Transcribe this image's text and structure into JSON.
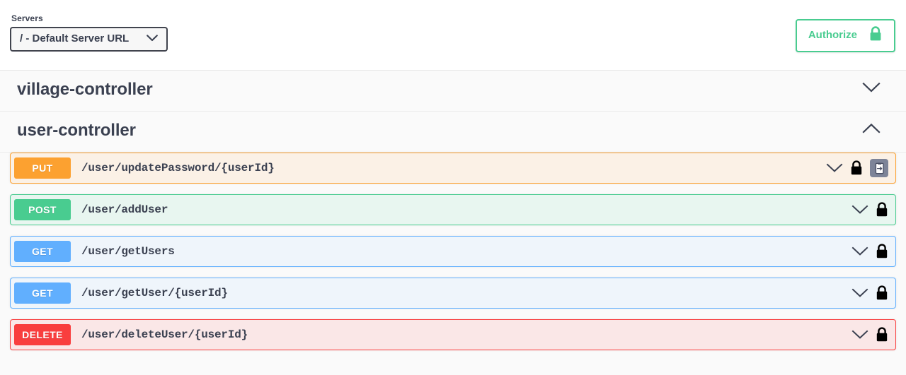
{
  "header": {
    "servers_label": "Servers",
    "server_selected": "/ - Default Server URL",
    "server_options": [
      "/ - Default Server URL"
    ],
    "authorize_label": "Authorize",
    "authorize_icon": "lock-icon",
    "authorize_color": "#49cc90"
  },
  "tags": [
    {
      "name": "village-controller",
      "expanded": false,
      "arrow_icon": "chevron-down-icon",
      "operations": []
    },
    {
      "name": "user-controller",
      "expanded": true,
      "arrow_icon": "chevron-up-icon",
      "operations": [
        {
          "method": "PUT",
          "path": "/user/updatePassword/{userId}",
          "method_color": "#fca130",
          "background_color": "#fbf1e6",
          "icons": [
            "chevron-down-icon",
            "lock-icon",
            "copy-to-clipboard-icon"
          ]
        },
        {
          "method": "POST",
          "path": "/user/addUser",
          "method_color": "#49cc90",
          "background_color": "#e8f6f0",
          "icons": [
            "chevron-down-icon",
            "lock-icon"
          ]
        },
        {
          "method": "GET",
          "path": "/user/getUsers",
          "method_color": "#61affe",
          "background_color": "#eff5fb",
          "icons": [
            "chevron-down-icon",
            "lock-icon"
          ]
        },
        {
          "method": "GET",
          "path": "/user/getUser/{userId}",
          "method_color": "#61affe",
          "background_color": "#eff5fb",
          "icons": [
            "chevron-down-icon",
            "lock-icon"
          ]
        },
        {
          "method": "DELETE",
          "path": "/user/deleteUser/{userId}",
          "method_color": "#f93e3e",
          "background_color": "#fae7e7",
          "icons": [
            "chevron-down-icon",
            "lock-icon"
          ]
        }
      ]
    }
  ]
}
